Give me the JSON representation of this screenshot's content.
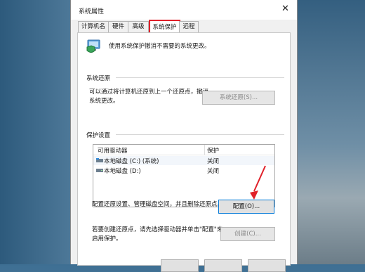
{
  "window": {
    "title": "系统属性",
    "close_glyph": "✕"
  },
  "tabs": [
    {
      "label": "计算机名",
      "active": false
    },
    {
      "label": "硬件",
      "active": false
    },
    {
      "label": "高级",
      "active": false
    },
    {
      "label": "系统保护",
      "active": true
    },
    {
      "label": "远程",
      "active": false
    }
  ],
  "header": {
    "description": "使用系统保护撤消不需要的系统更改。",
    "icon": "computer-shield-icon"
  },
  "restore": {
    "section_label": "系统还原",
    "text_line1": "可以通过将计算机还原到上一个还原点，撤消",
    "text_line2": "系统更改。",
    "button": "系统还原(S)..."
  },
  "protection": {
    "section_label": "保护设置",
    "columns": [
      "可用驱动器",
      "保护"
    ],
    "drives": [
      {
        "name": "本地磁盘 (C:) (系统)",
        "status": "关闭",
        "icon": "system-drive-icon"
      },
      {
        "name": "本地磁盘 (D:)",
        "status": "关闭",
        "icon": "drive-icon"
      }
    ]
  },
  "configure": {
    "text": "配置还原设置、管理磁盘空间，并且删除还原点。",
    "button": "配置(O)..."
  },
  "create": {
    "text_line1": "若要创建还原点，请先选择驱动器并单击\"配置\"来",
    "text_line2": "启用保护。",
    "button": "创建(C)..."
  },
  "colors": {
    "highlight": "#e0202a",
    "annotation_arrow": "#e0202a",
    "focus_border": "#0078d7"
  }
}
